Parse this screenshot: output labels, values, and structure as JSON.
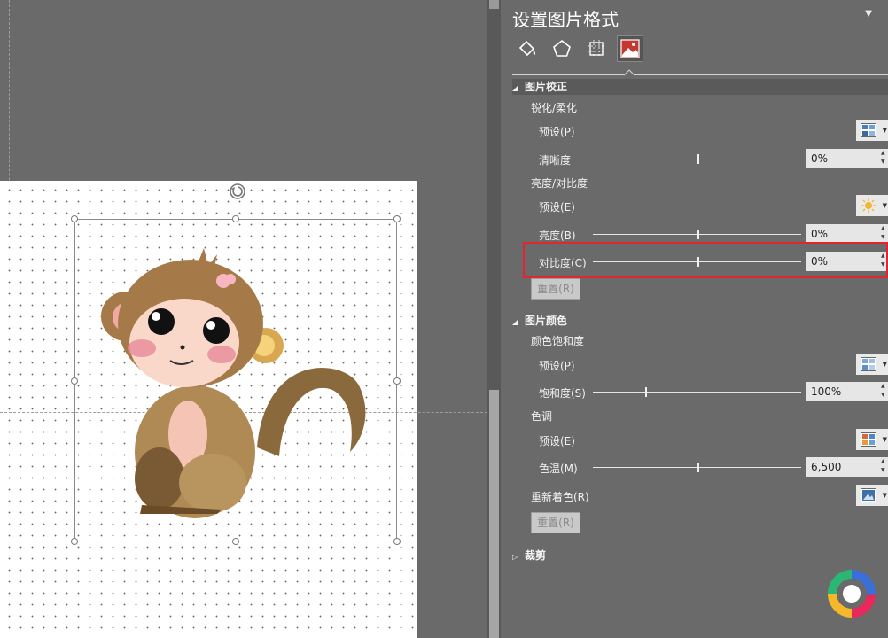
{
  "panel": {
    "title": "设置图片格式",
    "menu_glyph": "▼",
    "tabs": [
      {
        "name": "fill-line",
        "icon": "paint-bucket-icon"
      },
      {
        "name": "effects",
        "icon": "pentagon-icon"
      },
      {
        "name": "size-properties",
        "icon": "size-grid-icon"
      },
      {
        "name": "picture",
        "icon": "picture-icon",
        "active": true
      }
    ],
    "correction": {
      "title": "图片校正",
      "sharpen_soften": "锐化/柔化",
      "sharpen_preset_label": "预设(P)",
      "sharpness_label": "清晰度",
      "sharpness_value": "0%",
      "sharpness_level": 0.5,
      "brightness_contrast": "亮度/对比度",
      "bc_preset_label": "预设(E)",
      "brightness_label": "亮度(B)",
      "brightness_value": "0%",
      "brightness_level": 0.5,
      "contrast_label": "对比度(C)",
      "contrast_value": "0%",
      "contrast_level": 0.5,
      "reset_label": "重置(R)"
    },
    "color": {
      "title": "图片颜色",
      "saturation_group": "颜色饱和度",
      "saturation_preset_label": "预设(P)",
      "saturation_label": "饱和度(S)",
      "saturation_value": "100%",
      "saturation_level": 0.25,
      "tone_group": "色调",
      "tone_preset_label": "预设(E)",
      "temperature_label": "色温(M)",
      "temperature_value": "6,500",
      "temperature_level": 0.5,
      "recolor_label": "重新着色(R)",
      "reset_label": "重置(R)"
    },
    "crop": {
      "title": "裁剪"
    }
  },
  "colors": {
    "highlight": "#e3262d",
    "panel_bg": "#6a6a6a"
  }
}
